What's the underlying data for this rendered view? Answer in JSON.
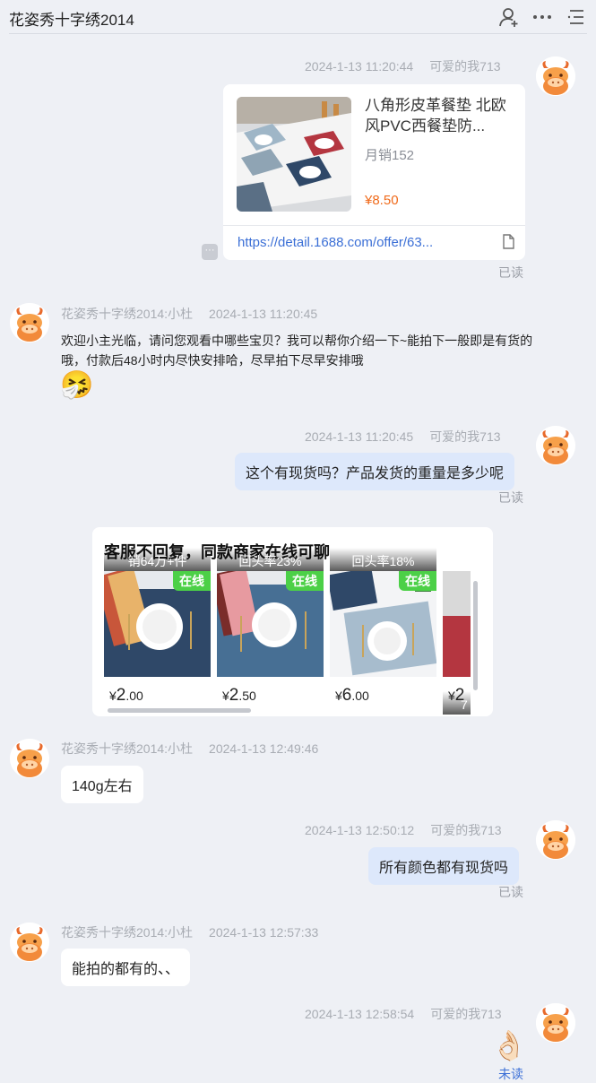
{
  "header": {
    "title": "花姿秀十字绣2014",
    "icons": [
      "user-add-icon",
      "more-icon",
      "menu-list-icon"
    ]
  },
  "messages": {
    "m1": {
      "time": "2024-1-13 11:20:44",
      "sender": "可爱的我713",
      "product": {
        "title": "八角形皮革餐垫 北欧风PVC西餐垫防...",
        "sales": "月销152",
        "price": "¥8.50",
        "link": "https://detail.1688.com/offer/63..."
      },
      "read": "已读"
    },
    "m2": {
      "sender": "花姿秀十字绣2014:小杜",
      "time": "2024-1-13 11:20:45",
      "text_line1": "欢迎小主光临，请问您观看中哪些宝贝？我可以帮你介绍一下~能拍下一般即是有货的",
      "text_line2": "哦，付款后48小时内尽快安排哈，尽早拍下尽早安排哦",
      "emoji": "🤧"
    },
    "m3": {
      "time": "2024-1-13 11:20:45",
      "sender": "可爱的我713",
      "text": "这个有现货吗？产品发货的重量是多少呢",
      "read": "已读"
    },
    "recommend": {
      "title": "客服不回复，同款商家在线可聊",
      "badge": "在线",
      "items": [
        {
          "caption": "销64万+件",
          "currency": "¥",
          "price_int": "2",
          "price_dec": ".00"
        },
        {
          "caption": "回头率23%",
          "currency": "¥",
          "price_int": "2",
          "price_dec": ".50"
        },
        {
          "caption": "回头率18%",
          "currency": "¥",
          "price_int": "6",
          "price_dec": ".00"
        },
        {
          "caption": "7",
          "currency": "¥",
          "price_int": "2",
          "price_dec": ""
        }
      ]
    },
    "m4": {
      "sender": "花姿秀十字绣2014:小杜",
      "time": "2024-1-13 12:49:46",
      "text": "140g左右"
    },
    "m5": {
      "time": "2024-1-13 12:50:12",
      "sender": "可爱的我713",
      "text": "所有颜色都有现货吗",
      "read": "已读"
    },
    "m6": {
      "sender": "花姿秀十字绣2014:小杜",
      "time": "2024-1-13 12:57:33",
      "text": "能拍的都有的、、"
    },
    "m7": {
      "time": "2024-1-13 12:58:54",
      "sender": "可爱的我713",
      "emoji": "👌🏻",
      "status": "未读"
    }
  },
  "colors": {
    "background": "#eef0f5",
    "outgoing_bubble": "#dde8fb",
    "price": "#f06a1a",
    "link": "#3b6fd6",
    "online_badge": "#4cd047"
  }
}
